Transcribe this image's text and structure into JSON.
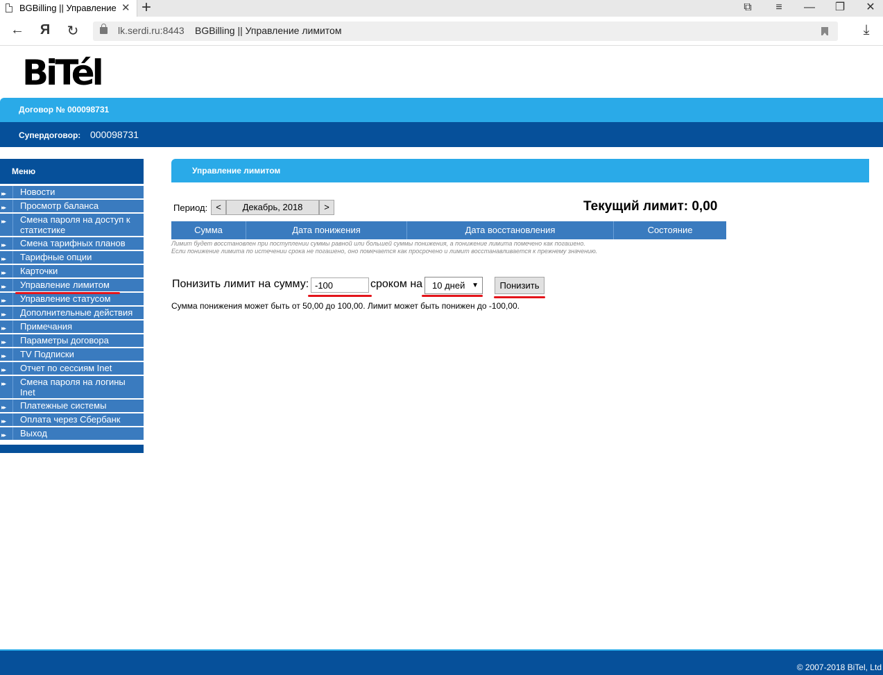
{
  "browser": {
    "tab_title": "BGBilling || Управление",
    "tab_close": "✕",
    "new_tab": "+",
    "url_host": "lk.serdi.ru:8443",
    "url_title": "BGBilling || Управление лимитом",
    "nav": {
      "back": "←",
      "yandex": "Я",
      "reload": "↻",
      "download": "⤓"
    },
    "window": {
      "collections": "⧉",
      "menu": "≡",
      "minimize": "—",
      "restore": "❐",
      "close": "✕"
    }
  },
  "logo": "BiTél",
  "contract": {
    "label": "Договор № 000098731"
  },
  "supercontract": {
    "label": "Супердоговор:",
    "value": "000098731"
  },
  "menu": {
    "title": "Меню",
    "items": [
      {
        "label": "Новости"
      },
      {
        "label": "Просмотр баланса"
      },
      {
        "label": "Смена пароля на доступ к статистике"
      },
      {
        "label": "Смена тарифных планов"
      },
      {
        "label": "Тарифные опции"
      },
      {
        "label": "Карточки"
      },
      {
        "label": "Управление лимитом"
      },
      {
        "label": "Управление статусом"
      },
      {
        "label": "Дополнительные действия"
      },
      {
        "label": "Примечания"
      },
      {
        "label": "Параметры договора"
      },
      {
        "label": "TV Подписки"
      },
      {
        "label": "Отчет по сессиям Inet"
      },
      {
        "label": "Смена пароля на логины Inet"
      },
      {
        "label": "Платежные системы"
      },
      {
        "label": "Оплата через Сбербанк"
      },
      {
        "label": "Выход"
      }
    ]
  },
  "section": {
    "title": "Управление лимитом"
  },
  "period": {
    "label": "Период:",
    "prev": "<",
    "value": "Декабрь, 2018",
    "next": ">"
  },
  "current_limit": "Текущий лимит: 0,00",
  "table": {
    "columns": [
      "Сумма",
      "Дата понижения",
      "Дата восстановления",
      "Состояние"
    ],
    "note1": "Лимит будет восстановлен при поступлении суммы равной или большей суммы понижения, а понижение лимита помечено как погашено.",
    "note2": "Если понижение лимита по истечении срока не погашено, оно помечается как просрочено и лимит восстанавливается к прежнему значению."
  },
  "form": {
    "lower_label": "Понизить лимит на сумму:",
    "amount_value": "-100",
    "term_label": "сроком на",
    "term_value": "10 дней",
    "submit_label": "Понизить",
    "hint": "Сумма понижения может быть от 50,00 до 100,00. Лимит может быть понижен до -100,00."
  },
  "footer": {
    "copyright": "© 2007-2018 BiTel, Ltd"
  },
  "colors": {
    "light_blue": "#2aaae8",
    "dark_blue": "#06509a",
    "menu_blue": "#3a7bbf",
    "highlight_red": "#e3141a"
  }
}
